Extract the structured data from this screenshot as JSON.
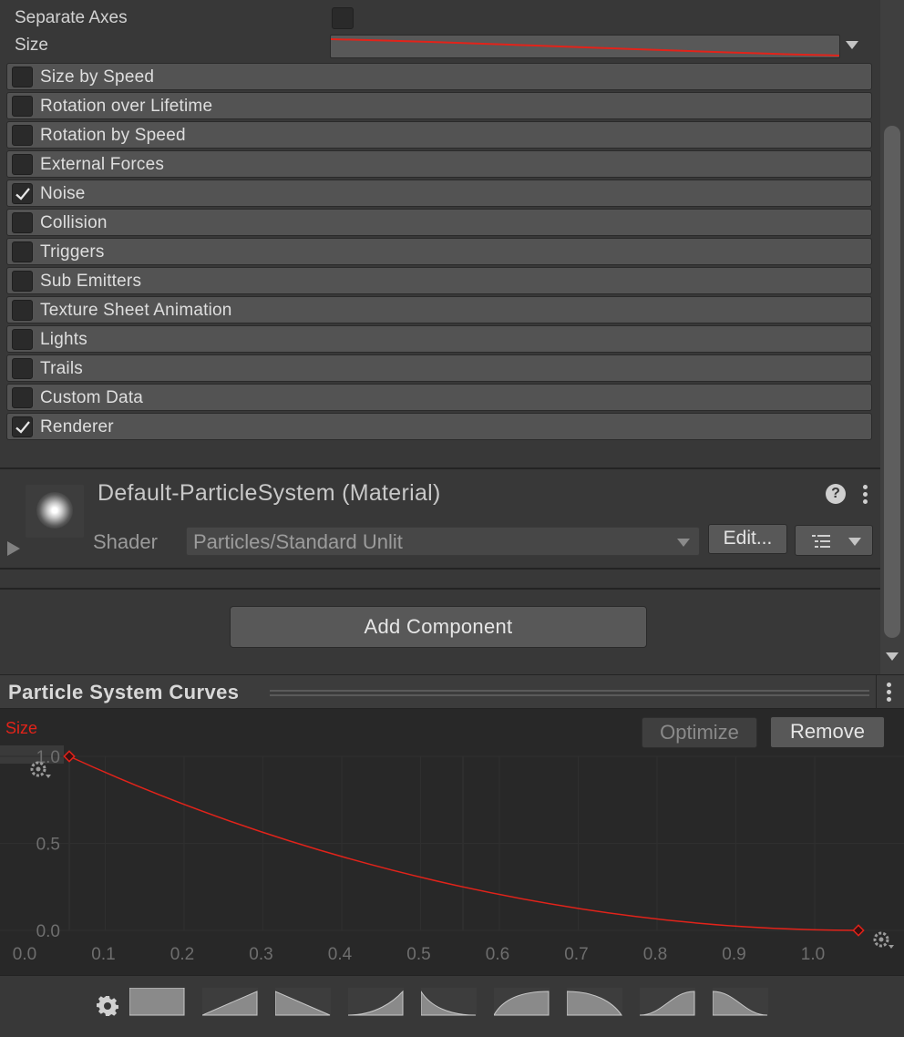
{
  "particle_system": {
    "separate_axes_label": "Separate Axes",
    "size_label": "Size",
    "modules": [
      {
        "label": "Size by Speed",
        "checked": false
      },
      {
        "label": "Rotation over Lifetime",
        "checked": false
      },
      {
        "label": "Rotation by Speed",
        "checked": false
      },
      {
        "label": "External Forces",
        "checked": false
      },
      {
        "label": "Noise",
        "checked": true
      },
      {
        "label": "Collision",
        "checked": false
      },
      {
        "label": "Triggers",
        "checked": false
      },
      {
        "label": "Sub Emitters",
        "checked": false
      },
      {
        "label": "Texture Sheet Animation",
        "checked": false
      },
      {
        "label": "Lights",
        "checked": false
      },
      {
        "label": "Trails",
        "checked": false
      },
      {
        "label": "Custom Data",
        "checked": false
      },
      {
        "label": "Renderer",
        "checked": true
      }
    ]
  },
  "material": {
    "title": "Default-ParticleSystem (Material)",
    "help_glyph": "?",
    "shader_label": "Shader",
    "shader_value": "Particles/Standard Unlit",
    "edit_label": "Edit..."
  },
  "add_component_label": "Add Component",
  "curves_panel": {
    "title": "Particle System Curves",
    "curve_name": "Size",
    "curve_color": "#e2231a",
    "optimize_label": "Optimize",
    "remove_label": "Remove",
    "y_ticks": [
      "1.0",
      "0.5",
      "0.0"
    ],
    "x_ticks": [
      "0.0",
      "0.1",
      "0.2",
      "0.3",
      "0.4",
      "0.5",
      "0.6",
      "0.7",
      "0.8",
      "0.9",
      "1.0"
    ],
    "keys": [
      {
        "time": 0.0,
        "value": 1.0
      },
      {
        "time": 1.0,
        "value": 0.0
      }
    ],
    "presets": [
      "constant",
      "linear-up",
      "linear-down",
      "ease-in-up",
      "ease-out-down",
      "ease-out-up",
      "ease-in-down",
      "ease-in-out-up",
      "ease-in-out-down"
    ]
  },
  "colors": {
    "panel_bg": "#383838",
    "module_bg": "#535353",
    "curve_bg": "#282828",
    "accent_red": "#e2231a"
  }
}
